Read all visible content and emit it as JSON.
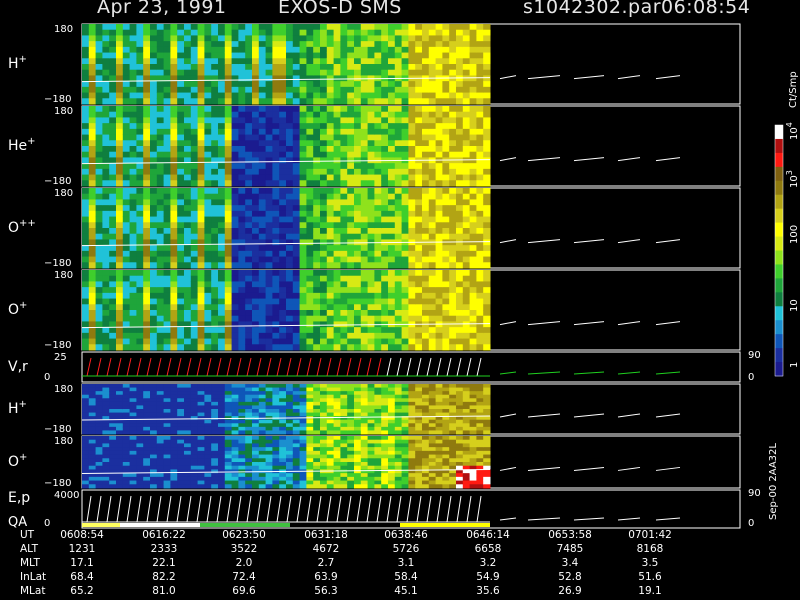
{
  "header": {
    "date": "Apr 23, 1991",
    "instrument": "EXOS-D SMS",
    "file": "s1042302.par",
    "time": "06:08:54"
  },
  "colors": {
    "background": "#000000",
    "spectrogram_scale": [
      "#1b1b8f",
      "#1b2f9f",
      "#0f56b8",
      "#1b8fcf",
      "#20c2d8",
      "#0f7f3f",
      "#1fa53a",
      "#3fcf2c",
      "#8fe21c",
      "#d8ea14",
      "#ffff00",
      "#d6cf1c",
      "#b2a414",
      "#8f7a0f",
      "#7f6010",
      "#ff1a12",
      "#b01010",
      "#ffffff"
    ]
  },
  "colorbar": {
    "unit": "Ct/Smp",
    "tick_labels": [
      "1",
      "10",
      "100",
      "10",
      "10"
    ],
    "exponents": [
      "",
      "",
      "",
      "3",
      "4"
    ]
  },
  "chart_data": {
    "type": "heatmap",
    "title": "Apr 23, 1991   EXOS-D SMS",
    "panels": [
      {
        "label": "H",
        "sup": "+",
        "ymin": "−180",
        "ymax": "180"
      },
      {
        "label": "He",
        "sup": "+",
        "ymin": "−180",
        "ymax": "180"
      },
      {
        "label": "O",
        "sup": "++",
        "ymin": "−180",
        "ymax": "180"
      },
      {
        "label": "O",
        "sup": "+",
        "ymin": "−180",
        "ymax": "180"
      },
      {
        "label": "V,r",
        "sup": "",
        "ymin": "0",
        "ymax": "25",
        "right_top": "90",
        "right_bottom": "0"
      },
      {
        "label": "H",
        "sup": "+",
        "ymin": "−180",
        "ymax": "180"
      },
      {
        "label": "O",
        "sup": "+",
        "ymin": "−180",
        "ymax": "180"
      },
      {
        "label": "E,p",
        "sup": "",
        "label2": "QA",
        "ymin": "0",
        "ymax": "4000",
        "right_top": "90",
        "right_bottom": "0"
      }
    ],
    "x_ticks": [
      "0608:54",
      "0616:22",
      "0623:50",
      "0631:18",
      "0638:46",
      "0646:14",
      "0653:58",
      "0701:42"
    ],
    "table": {
      "rows": [
        {
          "label": "UT",
          "values": [
            "0608:54",
            "0616:22",
            "0623:50",
            "0631:18",
            "0638:46",
            "0646:14",
            "0653:58",
            "0701:42"
          ]
        },
        {
          "label": "ALT",
          "values": [
            "1231",
            "2333",
            "3522",
            "4672",
            "5726",
            "6658",
            "7485",
            "8168"
          ]
        },
        {
          "label": "MLT",
          "values": [
            "17.1",
            "22.1",
            "2.0",
            "2.7",
            "3.1",
            "3.2",
            "3.4",
            "3.5"
          ]
        },
        {
          "label": "InLat",
          "values": [
            "68.4",
            "82.2",
            "72.4",
            "63.9",
            "58.4",
            "54.9",
            "52.8",
            "51.6"
          ]
        },
        {
          "label": "MLat",
          "values": [
            "65.2",
            "81.0",
            "69.6",
            "56.3",
            "45.1",
            "35.6",
            "26.9",
            "19.1"
          ]
        }
      ]
    },
    "footer_stamp": "Sep-00  2AA32L"
  }
}
